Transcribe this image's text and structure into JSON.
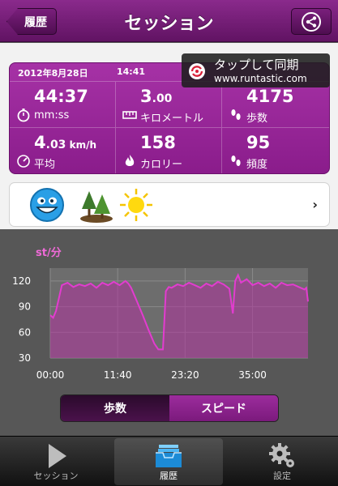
{
  "nav": {
    "back_label": "履歴",
    "title": "セッション"
  },
  "tooltip": {
    "line1": "タップして同期",
    "line2": "www.runtastic.com"
  },
  "stats": {
    "date": "2012年8月28日",
    "time": "14:41",
    "cells": [
      {
        "value": "44:37",
        "label": "mm:ss",
        "icon": "stopwatch-icon"
      },
      {
        "value_main": "3",
        "value_small": ".00",
        "label": "キロメートル",
        "icon": "ruler-icon"
      },
      {
        "value": "4175",
        "label": "歩数",
        "icon": "footprints-icon"
      },
      {
        "value_main": "4",
        "value_small": ".03",
        "unit": " km/h",
        "label": "平均",
        "icon": "speedometer-icon"
      },
      {
        "value": "158",
        "label": "カロリー",
        "icon": "flame-icon"
      },
      {
        "value": "95",
        "label": "頻度",
        "icon": "footprints-icon"
      }
    ]
  },
  "conditions": {
    "mood_icon": "smiley-icon",
    "surface_icon": "trees-icon",
    "weather_icon": "sun-icon",
    "chevron": "›"
  },
  "chart_data": {
    "type": "area",
    "ylabel": "st/分",
    "yticks": [
      120,
      90,
      60,
      30
    ],
    "ylim": [
      30,
      135
    ],
    "xticks": [
      "00:00",
      "11:40",
      "23:20",
      "35:00"
    ],
    "xlim_minutes": [
      0,
      44.6
    ],
    "color": "#e23ccf",
    "x": [
      0,
      0.5,
      1,
      2,
      3,
      4,
      5,
      6,
      7,
      8,
      9,
      10,
      11,
      12,
      13,
      13.5,
      14,
      15,
      16,
      17,
      18,
      18.7,
      19,
      19.5,
      20,
      20.5,
      21,
      22,
      23,
      24,
      25,
      26,
      27,
      28,
      29,
      30,
      31,
      31.6,
      32,
      32.5,
      33,
      34,
      35,
      36,
      37,
      38,
      39,
      40,
      41,
      42,
      43,
      44,
      44.3,
      44.6
    ],
    "y": [
      80,
      77,
      85,
      115,
      118,
      113,
      116,
      114,
      117,
      112,
      118,
      115,
      119,
      115,
      120,
      117,
      112,
      96,
      80,
      63,
      47,
      40,
      40,
      40,
      108,
      113,
      112,
      116,
      114,
      118,
      115,
      112,
      117,
      114,
      119,
      116,
      111,
      82,
      120,
      127,
      118,
      122,
      115,
      118,
      114,
      117,
      112,
      118,
      115,
      116,
      113,
      110,
      112,
      96
    ]
  },
  "segments": {
    "steps_label": "歩数",
    "speed_label": "スピード"
  },
  "tabs": {
    "session_label": "セッション",
    "history_label": "履歴",
    "settings_label": "設定"
  }
}
